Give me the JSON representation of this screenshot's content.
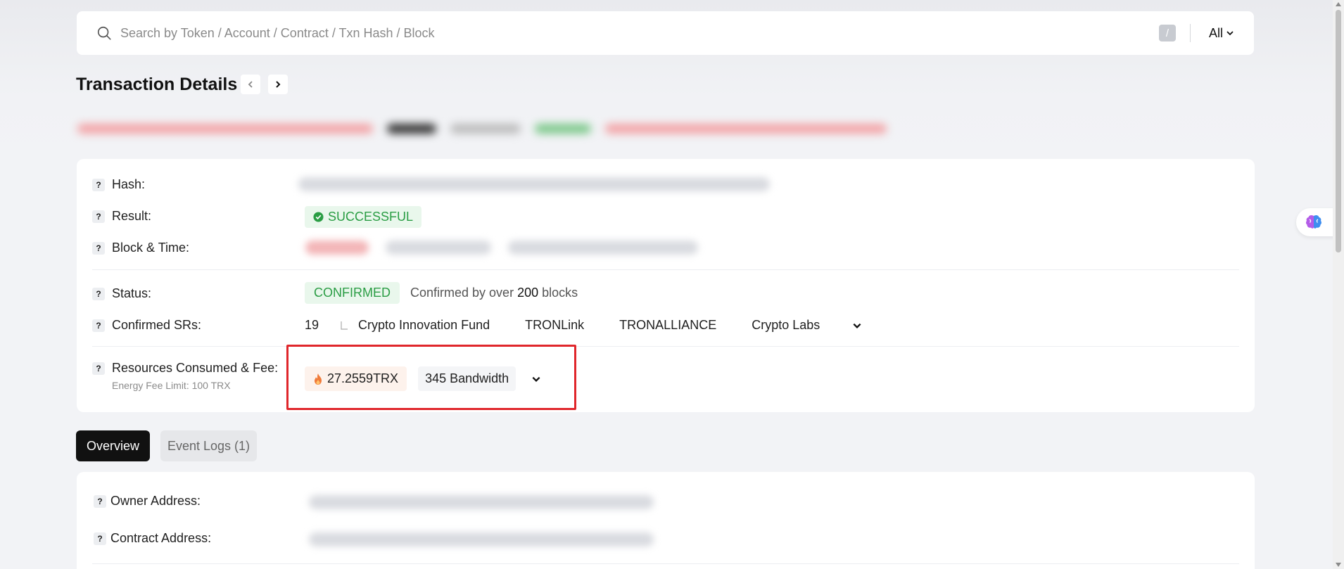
{
  "search": {
    "placeholder": "Search by Token / Account / Contract / Txn Hash / Block",
    "shortcut": "/",
    "filter_label": "All"
  },
  "page": {
    "title": "Transaction Details"
  },
  "details": {
    "hash_label": "Hash:",
    "result_label": "Result:",
    "result_value": "SUCCESSFUL",
    "block_time_label": "Block & Time:",
    "status_label": "Status:",
    "status_value": "CONFIRMED",
    "confirmed_prefix": "Confirmed by over",
    "confirmed_count": "200",
    "confirmed_suffix": "blocks",
    "srs_label": "Confirmed SRs:",
    "srs_count": "19",
    "srs": [
      "Crypto Innovation Fund",
      "TRONLink",
      "TRONALLIANCE",
      "Crypto Labs"
    ],
    "resources_label": "Resources Consumed & Fee:",
    "energy_limit_note": "Energy Fee Limit: 100 TRX",
    "fee_value": "27.2559TRX",
    "bandwidth_value": "345 Bandwidth"
  },
  "tabs": {
    "overview": "Overview",
    "event_logs": "Event Logs (1)"
  },
  "overview": {
    "owner_label": "Owner Address:",
    "contract_label": "Contract Address:"
  },
  "colors": {
    "success": "#2a9d44",
    "highlight": "#e0262b",
    "accent_dark": "#111111"
  }
}
